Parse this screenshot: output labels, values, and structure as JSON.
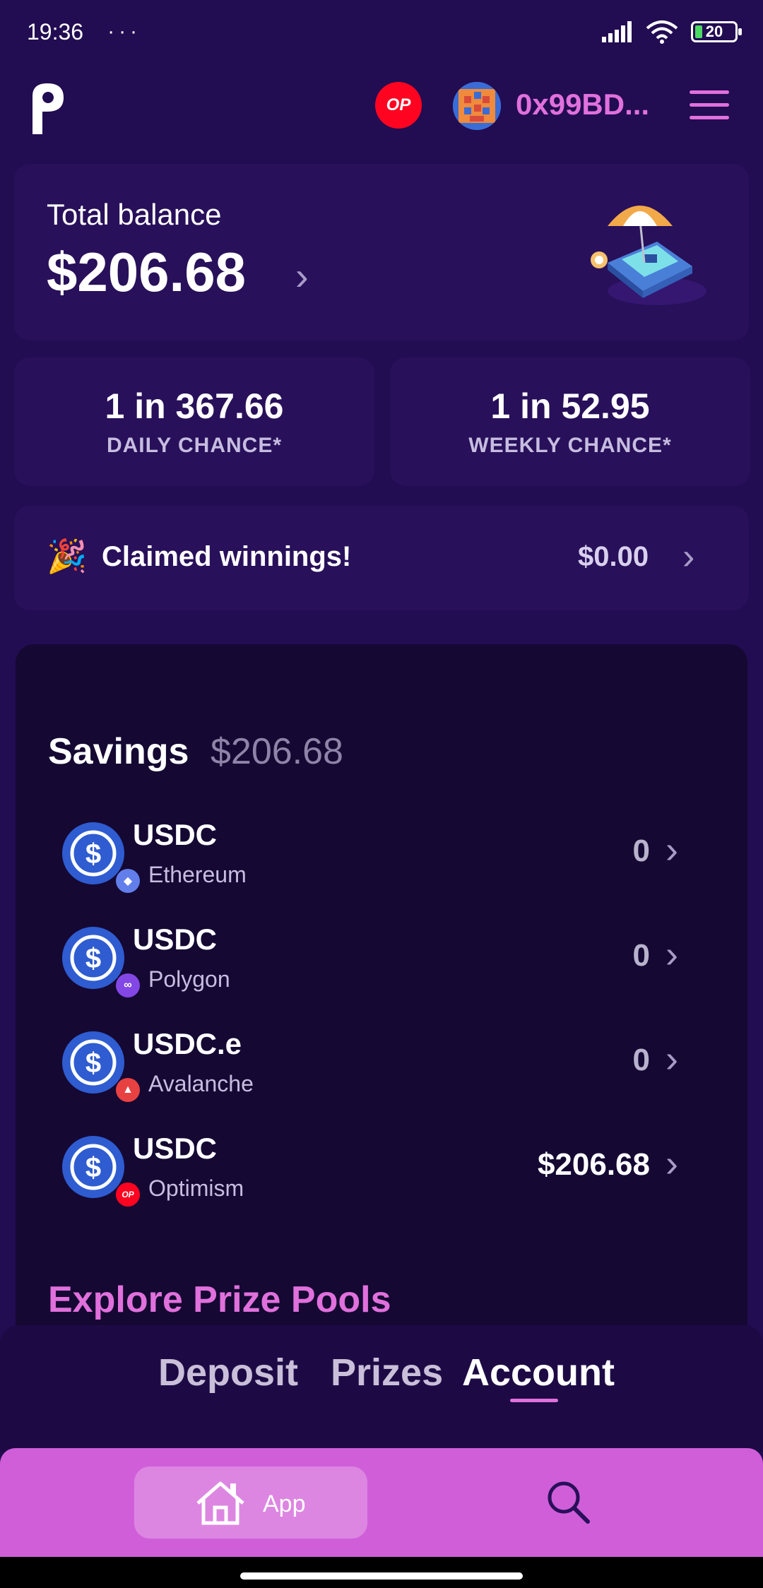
{
  "status_bar": {
    "time": "19:36",
    "dots": "···",
    "battery": "20"
  },
  "header": {
    "network_badge": "OP",
    "address": "0x99BD..."
  },
  "balance": {
    "label": "Total balance",
    "value": "$206.68"
  },
  "chances": [
    {
      "value": "1 in 367.66",
      "label": "DAILY CHANCE*"
    },
    {
      "value": "1 in 52.95",
      "label": "WEEKLY CHANCE*"
    }
  ],
  "winnings": {
    "icon": "party-popper-icon",
    "label": "Claimed winnings!",
    "amount": "$0.00"
  },
  "savings": {
    "title": "Savings",
    "total": "$206.68",
    "tokens": [
      {
        "symbol": "USDC",
        "chain": "Ethereum",
        "amount": "0",
        "chain_color": "#627eea"
      },
      {
        "symbol": "USDC",
        "chain": "Polygon",
        "amount": "0",
        "chain_color": "#8247e5"
      },
      {
        "symbol": "USDC.e",
        "chain": "Avalanche",
        "amount": "0",
        "chain_color": "#e84142"
      },
      {
        "symbol": "USDC",
        "chain": "Optimism",
        "amount": "$206.68",
        "chain_color": "#ff0420"
      }
    ]
  },
  "explore": "Explore Prize Pools",
  "tabs": [
    {
      "label": "Deposit"
    },
    {
      "label": "Prizes"
    },
    {
      "label": "Account",
      "active": true
    }
  ],
  "browser": {
    "app_label": "App"
  },
  "colors": {
    "background": "#220c52",
    "card": "#28105a",
    "accent": "#e070dc",
    "browser_bar": "#d05ed9"
  }
}
